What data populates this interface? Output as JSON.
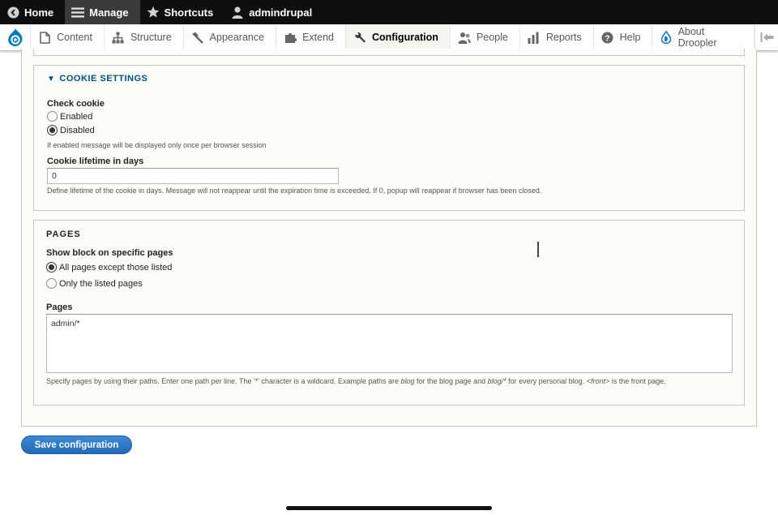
{
  "toolbar": {
    "items": [
      {
        "label": "Home",
        "icon": "back-circle-icon",
        "active": false
      },
      {
        "label": "Manage",
        "icon": "hamburger-menu-icon",
        "active": true
      },
      {
        "label": "Shortcuts",
        "icon": "star-icon",
        "active": false
      },
      {
        "label": "admindrupal",
        "icon": "user-icon",
        "active": false
      }
    ]
  },
  "tray": {
    "logo": "drupal-logo-icon",
    "items": [
      {
        "label": "Content",
        "icon": "page-icon"
      },
      {
        "label": "Structure",
        "icon": "structure-icon"
      },
      {
        "label": "Appearance",
        "icon": "paintbrush-icon"
      },
      {
        "label": "Extend",
        "icon": "puzzle-icon"
      },
      {
        "label": "Configuration",
        "icon": "wrench-icon",
        "active": true
      },
      {
        "label": "People",
        "icon": "people-icon"
      },
      {
        "label": "Reports",
        "icon": "bar-chart-icon"
      },
      {
        "label": "Help",
        "icon": "help-icon"
      },
      {
        "label": "About Droopler",
        "icon": "droopler-icon"
      }
    ]
  },
  "cookie_settings": {
    "legend": "COOKIE SETTINGS",
    "check_cookie_label": "Check cookie",
    "options": [
      "Enabled",
      "Disabled"
    ],
    "selected": "Disabled",
    "check_cookie_desc": "If enabled message will be displayed only once per browser session",
    "lifetime_label": "Cookie lifetime in days",
    "lifetime_value": "0",
    "lifetime_desc": "Define lifetime of the cookie in days. Message will not reappear until the expiration time is exceeded. If 0, popup will reappear if browser has been closed."
  },
  "pages": {
    "legend": "PAGES",
    "show_label": "Show block on specific pages",
    "options": [
      "All pages except those listed",
      "Only the listed pages"
    ],
    "selected": "All pages except those listed",
    "pages_label": "Pages",
    "pages_value": "admin/*",
    "desc_parts": {
      "a": "Specify pages by using their paths. Enter one path per line. The '*' character is a wildcard. Example paths are ",
      "b": "blog",
      "c": " for the blog page and ",
      "d": "blog/*",
      "e": " for every personal blog. ",
      "f": "<front>",
      "g": " is the front page."
    }
  },
  "actions": {
    "save_label": "Save configuration"
  },
  "colors": {
    "toolbar_bg": "#0f0f0f",
    "link": "#004f80",
    "primary_button": "#2369b3"
  }
}
